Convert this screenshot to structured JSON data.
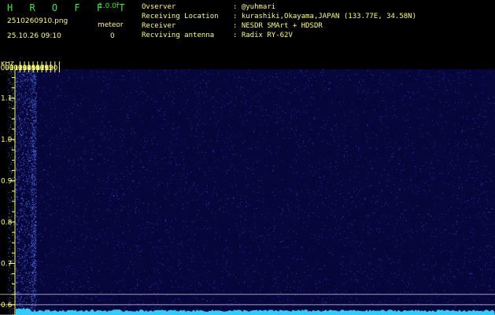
{
  "app": {
    "brand": "H R O F F T",
    "version": "1.0.0f",
    "filename": "2510260910.png",
    "meteor_label": "meteor",
    "datetime": "25.10.26 09:10",
    "meteor_count": "0"
  },
  "info": [
    {
      "label": "Ovserver",
      "value": ": @yuhmari"
    },
    {
      "label": "Receiving Location",
      "value": ": kurashiki,Okayama,JAPAN (133.77E, 34.58N)"
    },
    {
      "label": "Receiver",
      "value": ": NESDR SMArt + HDSDR"
    },
    {
      "label": "Recviving antenna",
      "value": ": Radix RY-62V"
    }
  ],
  "colors": {
    "background": "#000000",
    "header_text": "#ffff66",
    "brand": "#33ee33",
    "spectrogram_base": "#06063a",
    "noise_dots": "#3a4cff",
    "signal_trace": "#33ccff",
    "axis_lines": "#ffff66"
  },
  "chart_data": {
    "type": "heatmap",
    "title": "",
    "ylabel": "kHz",
    "xlabel": "",
    "x_ticks": [
      "0911",
      "0912",
      "0913",
      "0914",
      "0915",
      "0916",
      "0917",
      "0918",
      "0919",
      "0920"
    ],
    "y_ticks": [
      1.1,
      1.0,
      0.9,
      0.8,
      0.7,
      0.6
    ],
    "y_tick_labels": [
      "1.1",
      "1.0",
      "0.9",
      "0.8",
      "0.7",
      "0.6"
    ],
    "ylim": [
      0.575,
      1.17
    ],
    "xlim_minutes": [
      9.1,
      10.2
    ],
    "reference_lines_khz": [
      0.625,
      0.6,
      0.575
    ],
    "description_values": {
      "bright_columns_minutes": [
        9.1,
        9.13
      ],
      "meteor_count": 0
    }
  }
}
